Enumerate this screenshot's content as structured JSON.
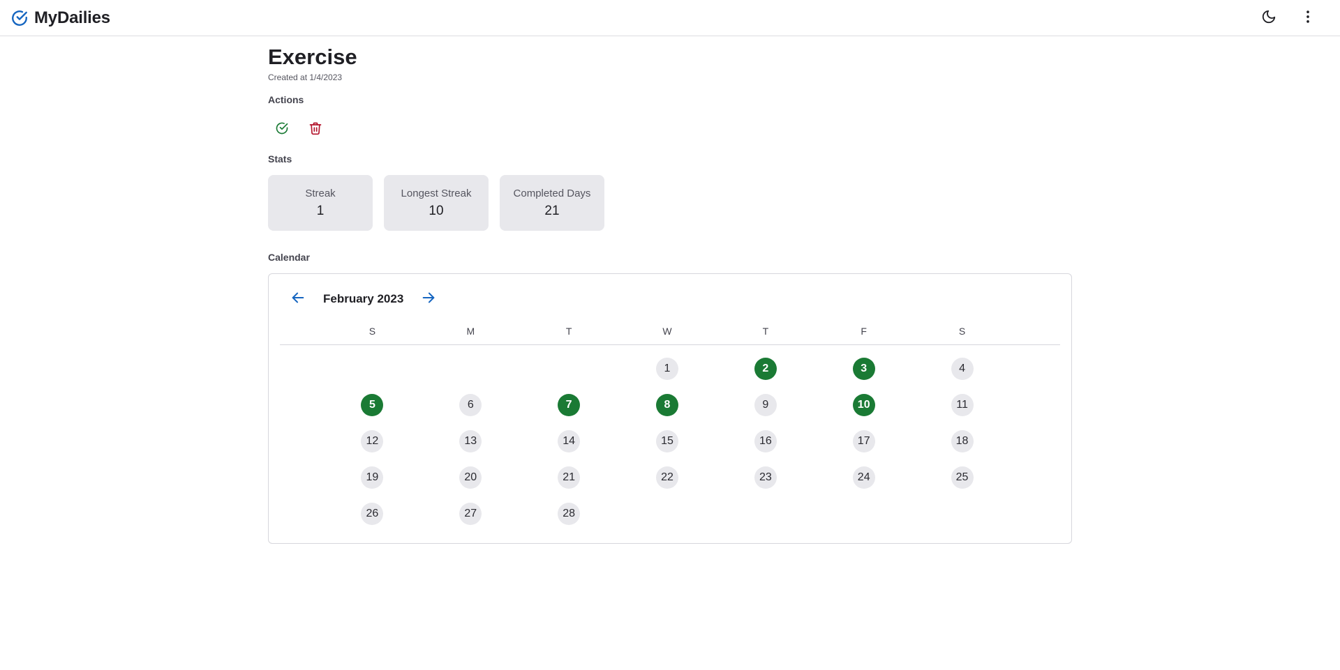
{
  "app": {
    "name": "MyDailies"
  },
  "icons": {
    "brand": "check-circle-icon",
    "theme": "moon-icon",
    "menu": "more-vertical-icon",
    "complete": "check-circle-icon",
    "delete": "trash-icon",
    "prev": "arrow-left-icon",
    "next": "arrow-right-icon"
  },
  "colors": {
    "accent": "#1565c0",
    "success": "#1a7a34",
    "danger": "#b3122a",
    "card": "#e8e8ec"
  },
  "habit": {
    "title": "Exercise",
    "created": "Created at 1/4/2023"
  },
  "sections": {
    "actions": "Actions",
    "stats": "Stats",
    "calendar": "Calendar"
  },
  "stats": [
    {
      "label": "Streak",
      "value": "1"
    },
    {
      "label": "Longest Streak",
      "value": "10"
    },
    {
      "label": "Completed Days",
      "value": "21"
    }
  ],
  "calendar": {
    "month_label": "February 2023",
    "weekdays": [
      "S",
      "M",
      "T",
      "W",
      "T",
      "F",
      "S"
    ],
    "first_weekday_index": 3,
    "days_in_month": 28,
    "completed_days": [
      2,
      3,
      5,
      7,
      8,
      10
    ]
  }
}
